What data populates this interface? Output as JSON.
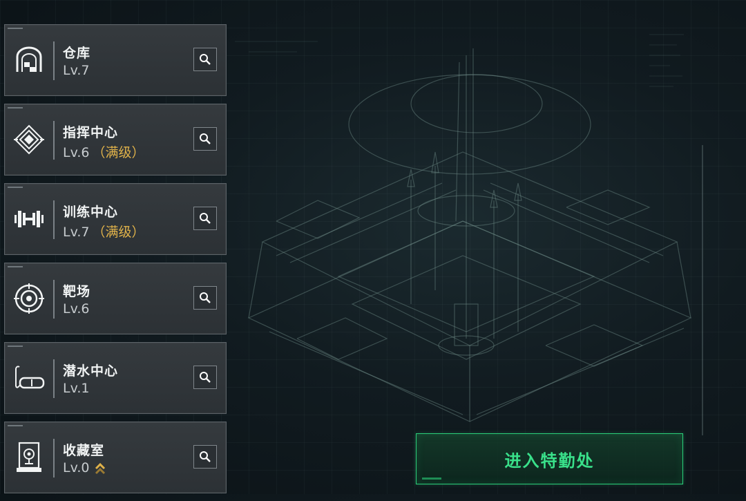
{
  "buildings": [
    {
      "name": "仓库",
      "level": "Lv.7",
      "status": "",
      "icon": "vault-door-icon"
    },
    {
      "name": "指挥中心",
      "level": "Lv.6",
      "status": "（满级）",
      "icon": "command-emblem-icon"
    },
    {
      "name": "训练中心",
      "level": "Lv.7",
      "status": "（满级）",
      "icon": "dumbbell-icon"
    },
    {
      "name": "靶场",
      "level": "Lv.6",
      "status": "",
      "icon": "target-icon"
    },
    {
      "name": "潜水中心",
      "level": "Lv.1",
      "status": "",
      "icon": "diving-mask-icon"
    },
    {
      "name": "收藏室",
      "level": "Lv.0",
      "status": "",
      "icon": "display-case-icon",
      "upgrade_icon": "upgrade-chevron-icon"
    }
  ],
  "enter_button": {
    "label": "进入特勤处"
  },
  "colors": {
    "accent_green": "#2bd07a",
    "max_level_gold": "#e0b24a",
    "card_bg": "#32373b"
  }
}
